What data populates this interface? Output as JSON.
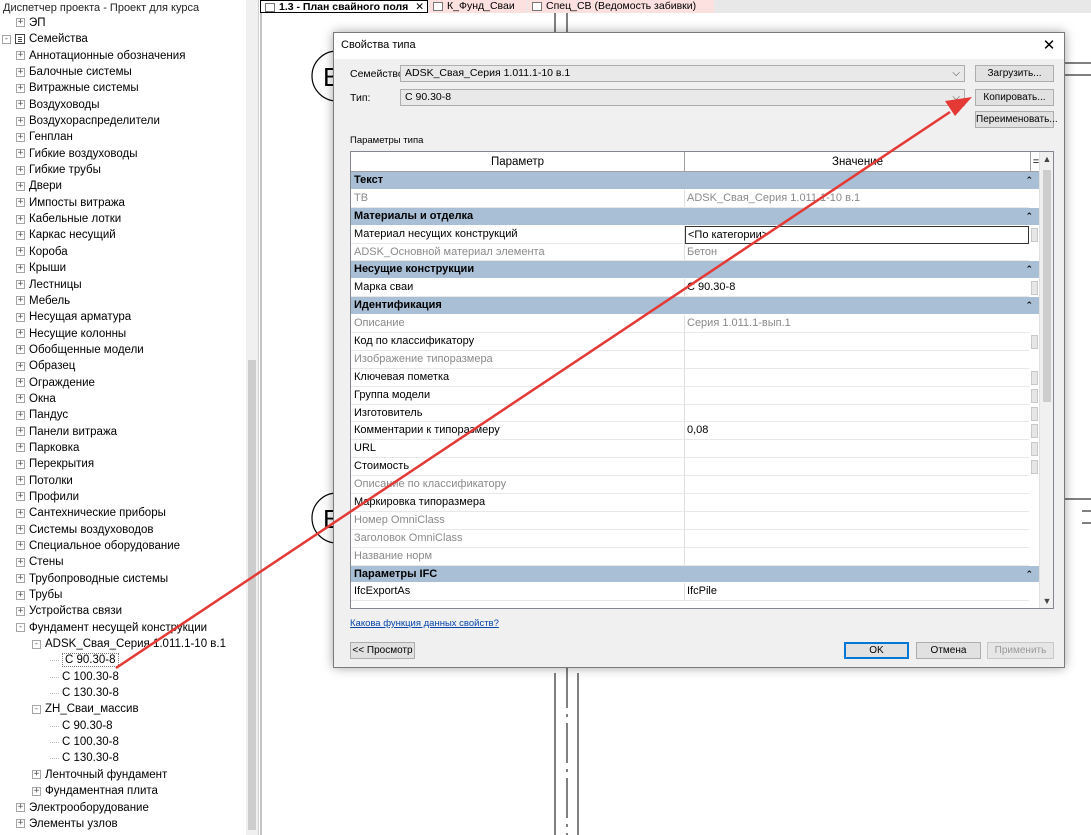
{
  "browser": {
    "title": "Диспетчер проекта - Проект для курса",
    "tree": [
      {
        "level": 1,
        "exp": "+",
        "label": "ЭП"
      },
      {
        "level": 0,
        "exp": "-",
        "icon": true,
        "label": "Семейства"
      },
      {
        "level": 1,
        "exp": "+",
        "label": "Аннотационные обозначения"
      },
      {
        "level": 1,
        "exp": "+",
        "label": "Балочные системы"
      },
      {
        "level": 1,
        "exp": "+",
        "label": "Витражные системы"
      },
      {
        "level": 1,
        "exp": "+",
        "label": "Воздуховоды"
      },
      {
        "level": 1,
        "exp": "+",
        "label": "Воздухораспределители"
      },
      {
        "level": 1,
        "exp": "+",
        "label": "Генплан"
      },
      {
        "level": 1,
        "exp": "+",
        "label": "Гибкие воздуховоды"
      },
      {
        "level": 1,
        "exp": "+",
        "label": "Гибкие трубы"
      },
      {
        "level": 1,
        "exp": "+",
        "label": "Двери"
      },
      {
        "level": 1,
        "exp": "+",
        "label": "Импосты витража"
      },
      {
        "level": 1,
        "exp": "+",
        "label": "Кабельные лотки"
      },
      {
        "level": 1,
        "exp": "+",
        "label": "Каркас несущий"
      },
      {
        "level": 1,
        "exp": "+",
        "label": "Короба"
      },
      {
        "level": 1,
        "exp": "+",
        "label": "Крыши"
      },
      {
        "level": 1,
        "exp": "+",
        "label": "Лестницы"
      },
      {
        "level": 1,
        "exp": "+",
        "label": "Мебель"
      },
      {
        "level": 1,
        "exp": "+",
        "label": "Несущая арматура"
      },
      {
        "level": 1,
        "exp": "+",
        "label": "Несущие колонны"
      },
      {
        "level": 1,
        "exp": "+",
        "label": "Обобщенные модели"
      },
      {
        "level": 1,
        "exp": "+",
        "label": "Образец"
      },
      {
        "level": 1,
        "exp": "+",
        "label": "Ограждение"
      },
      {
        "level": 1,
        "exp": "+",
        "label": "Окна"
      },
      {
        "level": 1,
        "exp": "+",
        "label": "Пандус"
      },
      {
        "level": 1,
        "exp": "+",
        "label": "Панели витража"
      },
      {
        "level": 1,
        "exp": "+",
        "label": "Парковка"
      },
      {
        "level": 1,
        "exp": "+",
        "label": "Перекрытия"
      },
      {
        "level": 1,
        "exp": "+",
        "label": "Потолки"
      },
      {
        "level": 1,
        "exp": "+",
        "label": "Профили"
      },
      {
        "level": 1,
        "exp": "+",
        "label": "Сантехнические приборы"
      },
      {
        "level": 1,
        "exp": "+",
        "label": "Системы воздуховодов"
      },
      {
        "level": 1,
        "exp": "+",
        "label": "Специальное оборудование"
      },
      {
        "level": 1,
        "exp": "+",
        "label": "Стены"
      },
      {
        "level": 1,
        "exp": "+",
        "label": "Трубопроводные системы"
      },
      {
        "level": 1,
        "exp": "+",
        "label": "Трубы"
      },
      {
        "level": 1,
        "exp": "+",
        "label": "Устройства связи"
      },
      {
        "level": 1,
        "exp": "-",
        "label": "Фундамент несущей конструкции"
      },
      {
        "level": 2,
        "exp": "-",
        "label": "ADSK_Свая_Серия 1.011.1-10 в.1"
      },
      {
        "level": 3,
        "label": "С 90.30-8",
        "selected": true
      },
      {
        "level": 3,
        "label": "С 100.30-8"
      },
      {
        "level": 3,
        "label": "С 130.30-8"
      },
      {
        "level": 2,
        "exp": "-",
        "label": "ZH_Сваи_массив"
      },
      {
        "level": 3,
        "label": "С 90.30-8"
      },
      {
        "level": 3,
        "label": "С 100.30-8"
      },
      {
        "level": 3,
        "label": "С 130.30-8"
      },
      {
        "level": 2,
        "exp": "+",
        "label": "Ленточный фундамент"
      },
      {
        "level": 2,
        "exp": "+",
        "label": "Фундаментная плита"
      },
      {
        "level": 1,
        "exp": "+",
        "label": "Электрооборудование"
      },
      {
        "level": 1,
        "exp": "+",
        "label": "Элементы узлов"
      }
    ]
  },
  "tabs": {
    "tab1": "1.3 - План свайного поля",
    "tab1_close": "✕",
    "tab2": "К_Фунд_Сваи",
    "tab3": "Спец_СВ (Ведомость забивки)"
  },
  "canvas": {
    "grid_label_top": "В",
    "grid_label_bottom": "Б"
  },
  "dialog": {
    "title": "Свойства типа",
    "close": "✕",
    "family_label": "Семейство:",
    "family_value": "ADSK_Свая_Серия 1.011.1-10 в.1",
    "type_label": "Тип:",
    "type_value": "С 90.30-8",
    "load_button": "Загрузить...",
    "copy_button": "Копировать...",
    "rename_button": "Переименовать...",
    "type_params_label": "Параметры типа",
    "col_param": "Параметр",
    "col_value": "Значение",
    "col_eq": "=",
    "help_link": "Какова функция данных свойств?",
    "preview_button": "<< Просмотр",
    "ok_button": "OK",
    "cancel_button": "Отмена",
    "apply_button": "Применить",
    "rows": [
      {
        "type": "group",
        "label": "Текст"
      },
      {
        "type": "row",
        "param": "ТВ",
        "value": "ADSK_Свая_Серия 1.011.1-10 в.1",
        "ro": true,
        "eq": false
      },
      {
        "type": "group",
        "label": "Материалы и отделка"
      },
      {
        "type": "row",
        "param": "Материал несущих конструкций",
        "value": "<По категории>",
        "focus": true,
        "eq": true
      },
      {
        "type": "row",
        "param": "ADSK_Основной материал элемента",
        "value": "Бетон",
        "ro": true,
        "eq": false
      },
      {
        "type": "group",
        "label": "Несущие конструкции"
      },
      {
        "type": "row",
        "param": "Марка сваи",
        "value": "С 90.30-8",
        "eq": true
      },
      {
        "type": "group",
        "label": "Идентификация"
      },
      {
        "type": "row",
        "param": "Описание",
        "value": "Серия 1.011.1-вып.1",
        "ro": true,
        "eq": false
      },
      {
        "type": "row",
        "param": "Код по классификатору",
        "value": "",
        "eq": true
      },
      {
        "type": "row",
        "param": "Изображение типоразмера",
        "value": "",
        "ro": true,
        "eq": false
      },
      {
        "type": "row",
        "param": "Ключевая пометка",
        "value": "",
        "eq": true
      },
      {
        "type": "row",
        "param": "Группа модели",
        "value": "",
        "eq": true
      },
      {
        "type": "row",
        "param": "Изготовитель",
        "value": "",
        "eq": true
      },
      {
        "type": "row",
        "param": "Комментарии к типоразмеру",
        "value": "0,08",
        "eq": true
      },
      {
        "type": "row",
        "param": "URL",
        "value": "",
        "eq": true
      },
      {
        "type": "row",
        "param": "Стоимость",
        "value": "",
        "eq": true
      },
      {
        "type": "row",
        "param": "Описание по классификатору",
        "value": "",
        "ro": true,
        "eq": false
      },
      {
        "type": "row",
        "param": "Маркировка типоразмера",
        "value": "",
        "eq": false
      },
      {
        "type": "row",
        "param": "Номер OmniClass",
        "value": "",
        "ro": true,
        "eq": false
      },
      {
        "type": "row",
        "param": "Заголовок OmniClass",
        "value": "",
        "ro": true,
        "eq": false
      },
      {
        "type": "row",
        "param": "Название норм",
        "value": "",
        "ro": true,
        "eq": false
      },
      {
        "type": "group",
        "label": "Параметры IFC"
      },
      {
        "type": "row",
        "param": "IfcExportAs",
        "value": "IfcPile",
        "eq": false
      }
    ]
  },
  "colors": {
    "group_header": "#a9bfd6",
    "annotation_arrow": "#e53935",
    "tab_inactive": "#fde0e0",
    "link": "#0645ad"
  }
}
